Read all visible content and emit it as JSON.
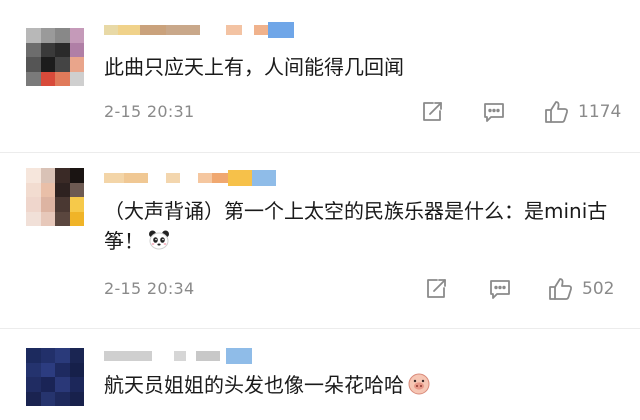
{
  "comments": [
    {
      "text": "此曲只应天上有，人间能得几回闻",
      "timestamp": "2-15 20:31",
      "like_count": "1174"
    },
    {
      "text": "（大声背诵）第一个上太空的民族乐器是什么：是mini古筝！",
      "emoji": "panda-emoji",
      "timestamp": "2-15 20:34",
      "like_count": "502"
    },
    {
      "text": "航天员姐姐的头发也像一朵花哈哈",
      "emoji": "pig-face-emoji"
    }
  ],
  "icons": {
    "share": "share-icon",
    "comment": "comment-icon",
    "like": "thumbs-up-icon"
  },
  "colors": {
    "text": "#1a1a1a",
    "meta": "#8a8a8a",
    "icon": "#8a8a8a"
  }
}
